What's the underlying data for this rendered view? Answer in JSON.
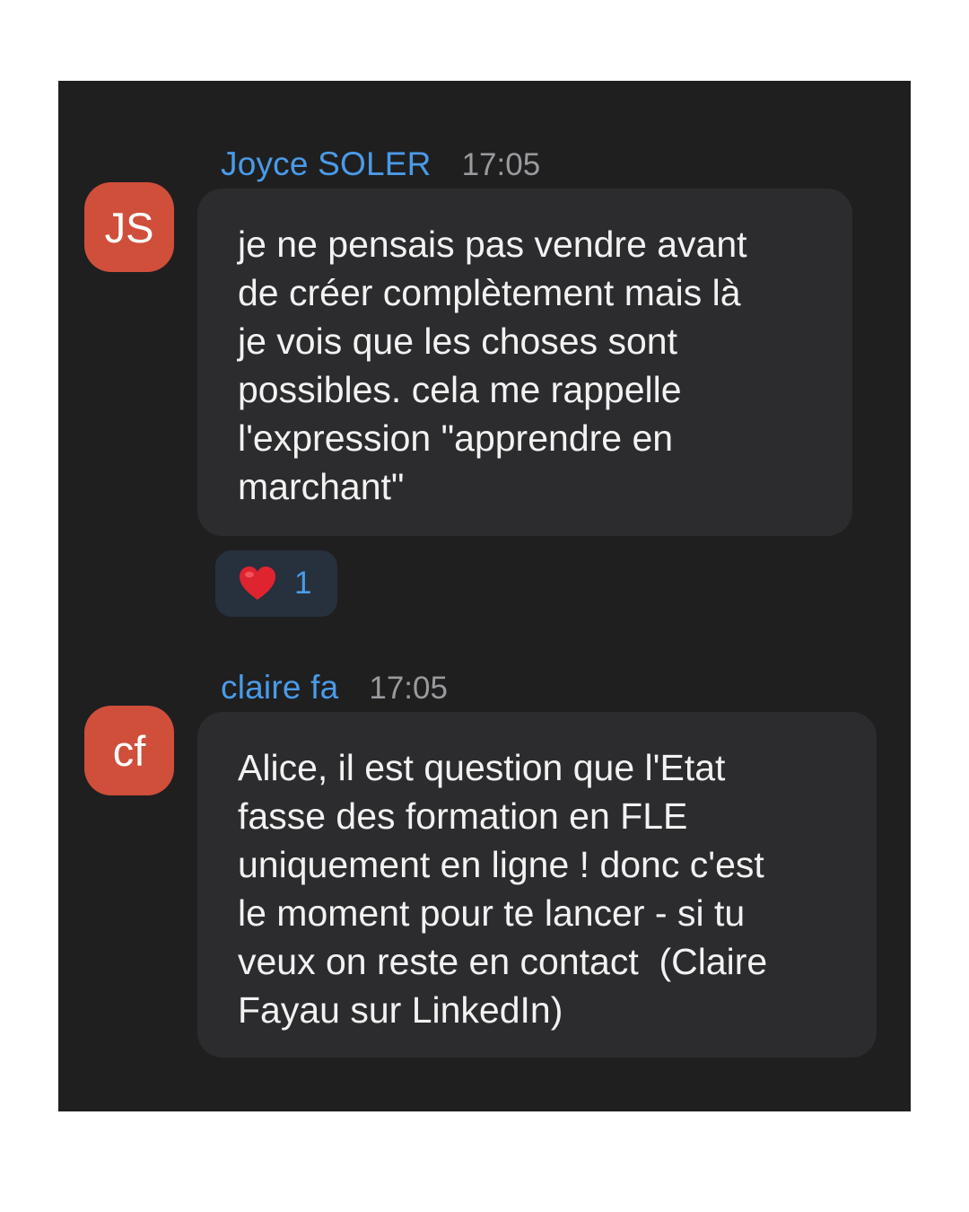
{
  "messages": [
    {
      "sender": "Joyce SOLER",
      "time": "17:05",
      "avatar_initials": "JS",
      "avatar_color": "#cf4f3a",
      "text": "je ne pensais pas vendre avant\nde créer complètement mais là\nje vois que les choses sont\npossibles. cela me rappelle\nl'expression \"apprendre en\nmarchant\"",
      "reaction": {
        "icon": "heart-icon",
        "count": "1"
      }
    },
    {
      "sender": "claire fa",
      "time": "17:05",
      "avatar_initials": "cf",
      "avatar_color": "#cf4f3a",
      "text": "Alice, il est question que l'Etat\nfasse des formation en FLE\nuniquement en ligne ! donc c'est\nle moment pour te lancer - si tu\nveux on reste en contact  (Claire\nFayau sur LinkedIn)"
    }
  ],
  "colors": {
    "panel_bg": "#1f1f20",
    "bubble_bg": "#2c2c2e",
    "sender_name": "#4a9be8",
    "reaction_bg": "#27303d"
  }
}
